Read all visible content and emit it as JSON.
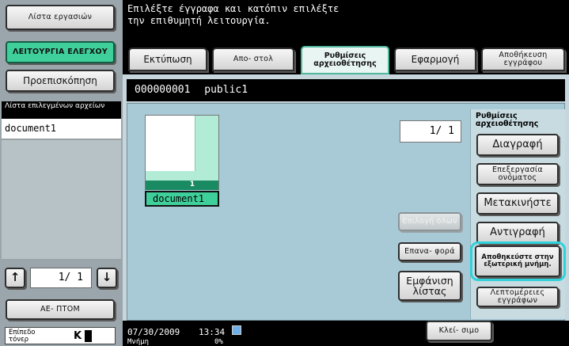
{
  "left": {
    "job_list_label": "Λίστα εργασιών",
    "functions_label": "ΛΕΙΤΟΥΡΓΙΑ ΕΛΕΓΧΟΥ",
    "preview_label": "Προεπισκόπηση",
    "selected_list_header": "Λίστα επιλεγμένων αρχείων",
    "selected_files": [
      "document1"
    ],
    "page_counter": "1/  1",
    "up_arrow": "↑",
    "down_arrow": "↓",
    "stop_label": "ΑΕ- ΠΤΟΜ",
    "toner_label": "Επίπεδο τόνερ",
    "toner_color": "K"
  },
  "message": {
    "line1": "Επιλέξτε έγγραφα και κατόπιν επιλέξτε",
    "line2": "την επιθυμητή λειτουργία."
  },
  "tabs": [
    {
      "label": "Εκτύπωση"
    },
    {
      "label": "Απο- στολ"
    },
    {
      "label": "Ρυθμίσεις αρχειοθέτησης"
    },
    {
      "label": "Εφαρμογή"
    },
    {
      "label": "Αποθήκευση εγγράφου"
    }
  ],
  "box": {
    "number": "000000001",
    "name": "public1"
  },
  "document": {
    "name": "document1",
    "page_badge": "1"
  },
  "page_indicator": "1/  1",
  "actions": {
    "select_all": "Επιλογή όλων",
    "reset": "Επανα- φορά",
    "list_view": "Εμφάνιση λίστας"
  },
  "side": {
    "header": "Ρυθμίσεις αρχειοθέτησης",
    "delete": "Διαγραφή",
    "edit_name": "Επεξεργασία ονόματος",
    "move": "Μετακινήστε",
    "copy": "Αντιγραφή",
    "save_external": "Αποθηκεύστε στην εξωτερική μνήμη.",
    "doc_details": "Λεπτομέρειες εγγράφων"
  },
  "status": {
    "date": "07/30/2009",
    "time": "13:34",
    "memory_label": "Μνήμη",
    "memory_value": "0%",
    "close_label": "Κλεί- σιμο"
  },
  "colors": {
    "accent": "#4fb89d",
    "highlight": "#2fd2d9",
    "green_button": "#3fcf9a"
  }
}
